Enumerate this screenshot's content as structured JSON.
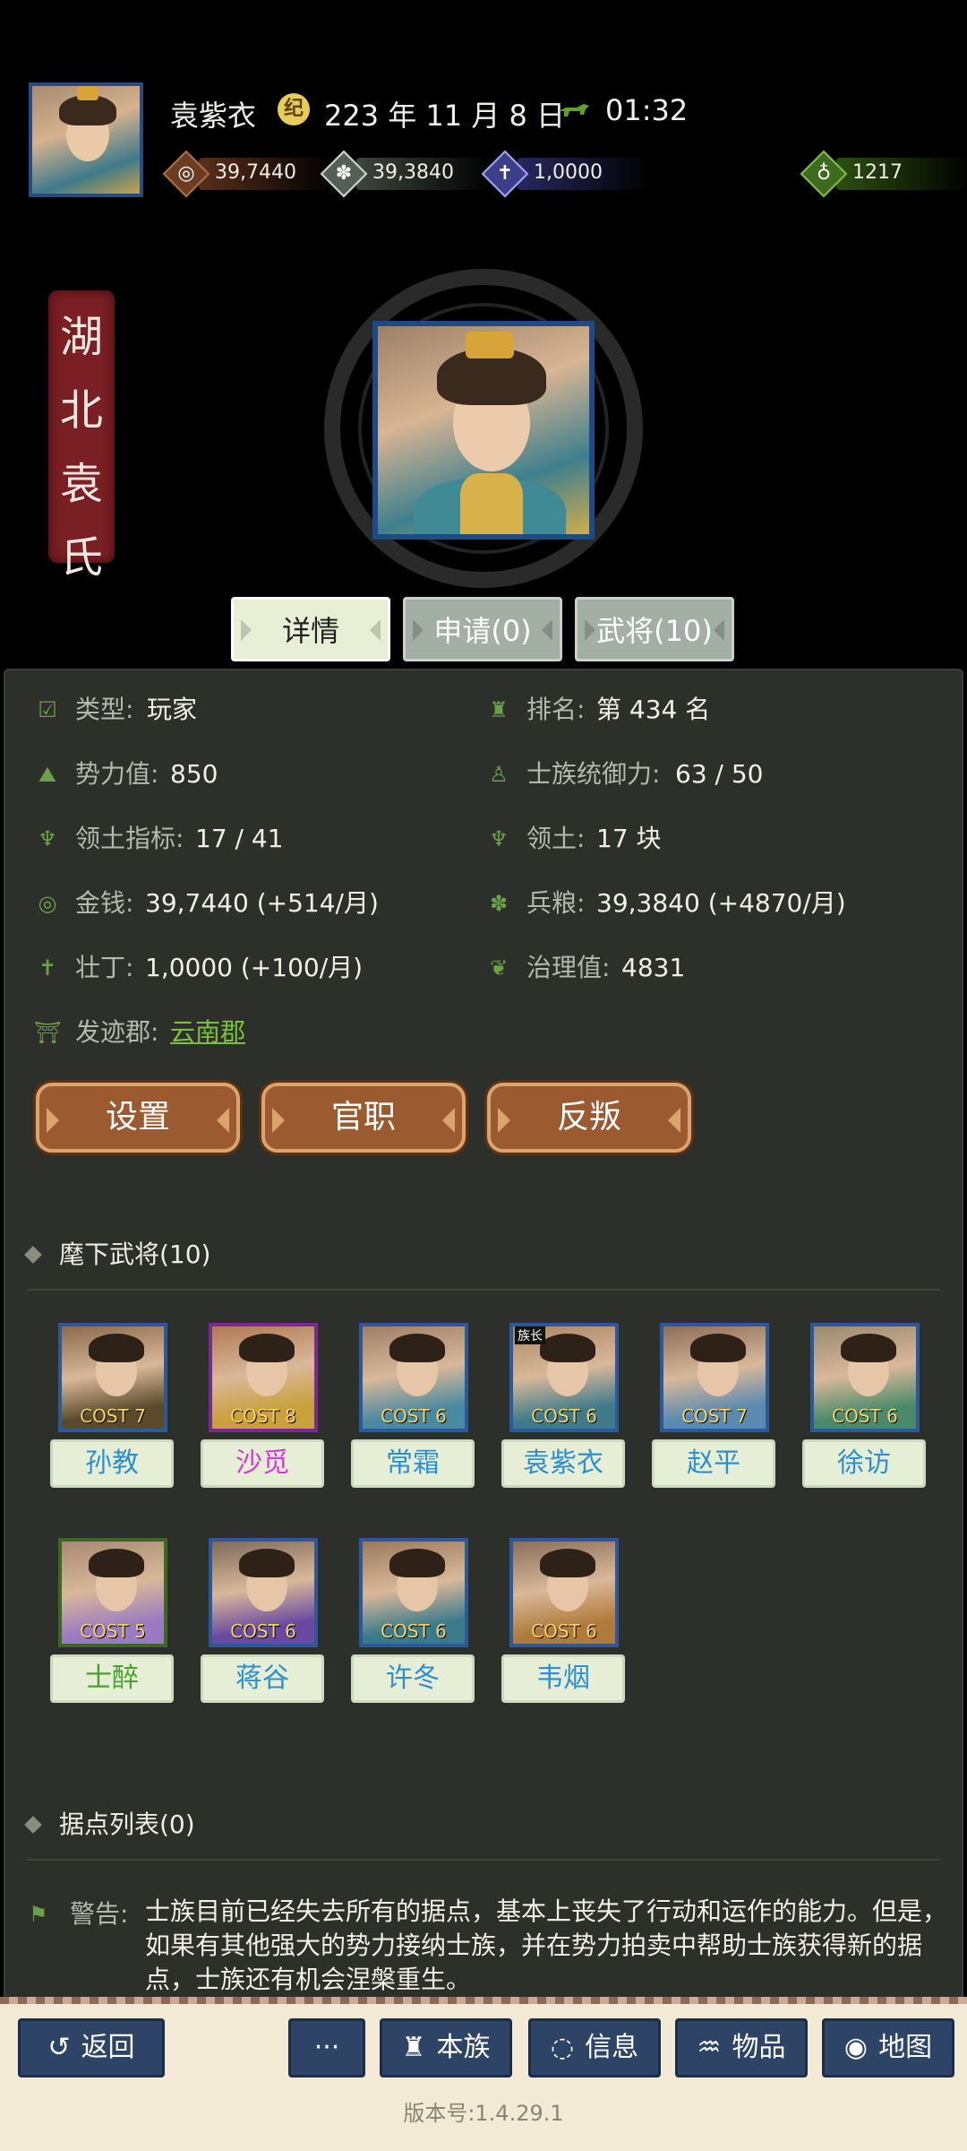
{
  "top": {
    "name": "袁紫衣",
    "date_icon": "纪",
    "date": "223 年 11 月 8 日",
    "time": "01:32",
    "resources": {
      "gold": "39,7440",
      "food": "39,3840",
      "men": "1,0000",
      "bag": "1217"
    }
  },
  "clan": {
    "chars": [
      "湖",
      "北",
      "袁",
      "氏"
    ]
  },
  "tabs": [
    {
      "label": "详情",
      "active": true
    },
    {
      "label": "申请(0)",
      "active": false
    },
    {
      "label": "武将(10)",
      "active": false
    }
  ],
  "details": {
    "type_label": "类型:",
    "type_value": "玩家",
    "rank_label": "排名:",
    "rank_value": "第 434 名",
    "power_label": "势力值:",
    "power_value": "850",
    "command_label": "士族统御力:",
    "command_value": "63 / 50",
    "territory_quota_label": "领土指标:",
    "territory_quota_value": "17 / 41",
    "territory_label": "领土:",
    "territory_value": "17 块",
    "money_label": "金钱:",
    "money_value": "39,7440 (+514/月)",
    "grain_label": "兵粮:",
    "grain_value": "39,3840 (+4870/月)",
    "manpower_label": "壮丁:",
    "manpower_value": "1,0000 (+100/月)",
    "governance_label": "治理值:",
    "governance_value": "4831",
    "origin_label": "发迹郡:",
    "origin_value": "云南郡"
  },
  "actions": {
    "settings": "设置",
    "office": "官职",
    "rebel": "反叛"
  },
  "generals_section": {
    "title": "麾下武将(10)",
    "list": [
      {
        "name": "孙教",
        "cost": "COST 7",
        "chief": "",
        "name_color": "#2c8fd0",
        "frame": "#2a5a9a"
      },
      {
        "name": "沙觅",
        "cost": "COST 8",
        "chief": "",
        "name_color": "#d63ad6",
        "frame": "#7a2a92"
      },
      {
        "name": "常霜",
        "cost": "COST 6",
        "chief": "",
        "name_color": "#2c8fd0",
        "frame": "#2a5a9a"
      },
      {
        "name": "袁紫衣",
        "cost": "COST 6",
        "chief": "族长",
        "name_color": "#2c8fd0",
        "frame": "#2a5a9a"
      },
      {
        "name": "赵平",
        "cost": "COST 7",
        "chief": "",
        "name_color": "#2c8fd0",
        "frame": "#2a5a9a"
      },
      {
        "name": "徐访",
        "cost": "COST 6",
        "chief": "",
        "name_color": "#2c8fd0",
        "frame": "#2a5a9a"
      },
      {
        "name": "士醉",
        "cost": "COST 5",
        "chief": "",
        "name_color": "#4aa02c",
        "frame": "#3a6a22"
      },
      {
        "name": "蒋谷",
        "cost": "COST 6",
        "chief": "",
        "name_color": "#2c8fd0",
        "frame": "#2a5a9a"
      },
      {
        "name": "许冬",
        "cost": "COST 6",
        "chief": "",
        "name_color": "#2c8fd0",
        "frame": "#2a5a9a"
      },
      {
        "name": "韦烟",
        "cost": "COST 6",
        "chief": "",
        "name_color": "#2c8fd0",
        "frame": "#2a5a9a"
      }
    ]
  },
  "stronghold_section": {
    "title": "据点列表(0)"
  },
  "warning": {
    "label": "警告:",
    "text": "士族目前已经失去所有的据点，基本上丧失了行动和运作的能力。但是，如果有其他强大的势力接纳士族，并在势力拍卖中帮助士族获得新的据点，士族还有机会涅槃重生。"
  },
  "nav": {
    "back": "返回",
    "more": "···",
    "clan": "本族",
    "info": "信息",
    "items": "物品",
    "map": "地图"
  },
  "version": "版本号:1.4.29.1"
}
